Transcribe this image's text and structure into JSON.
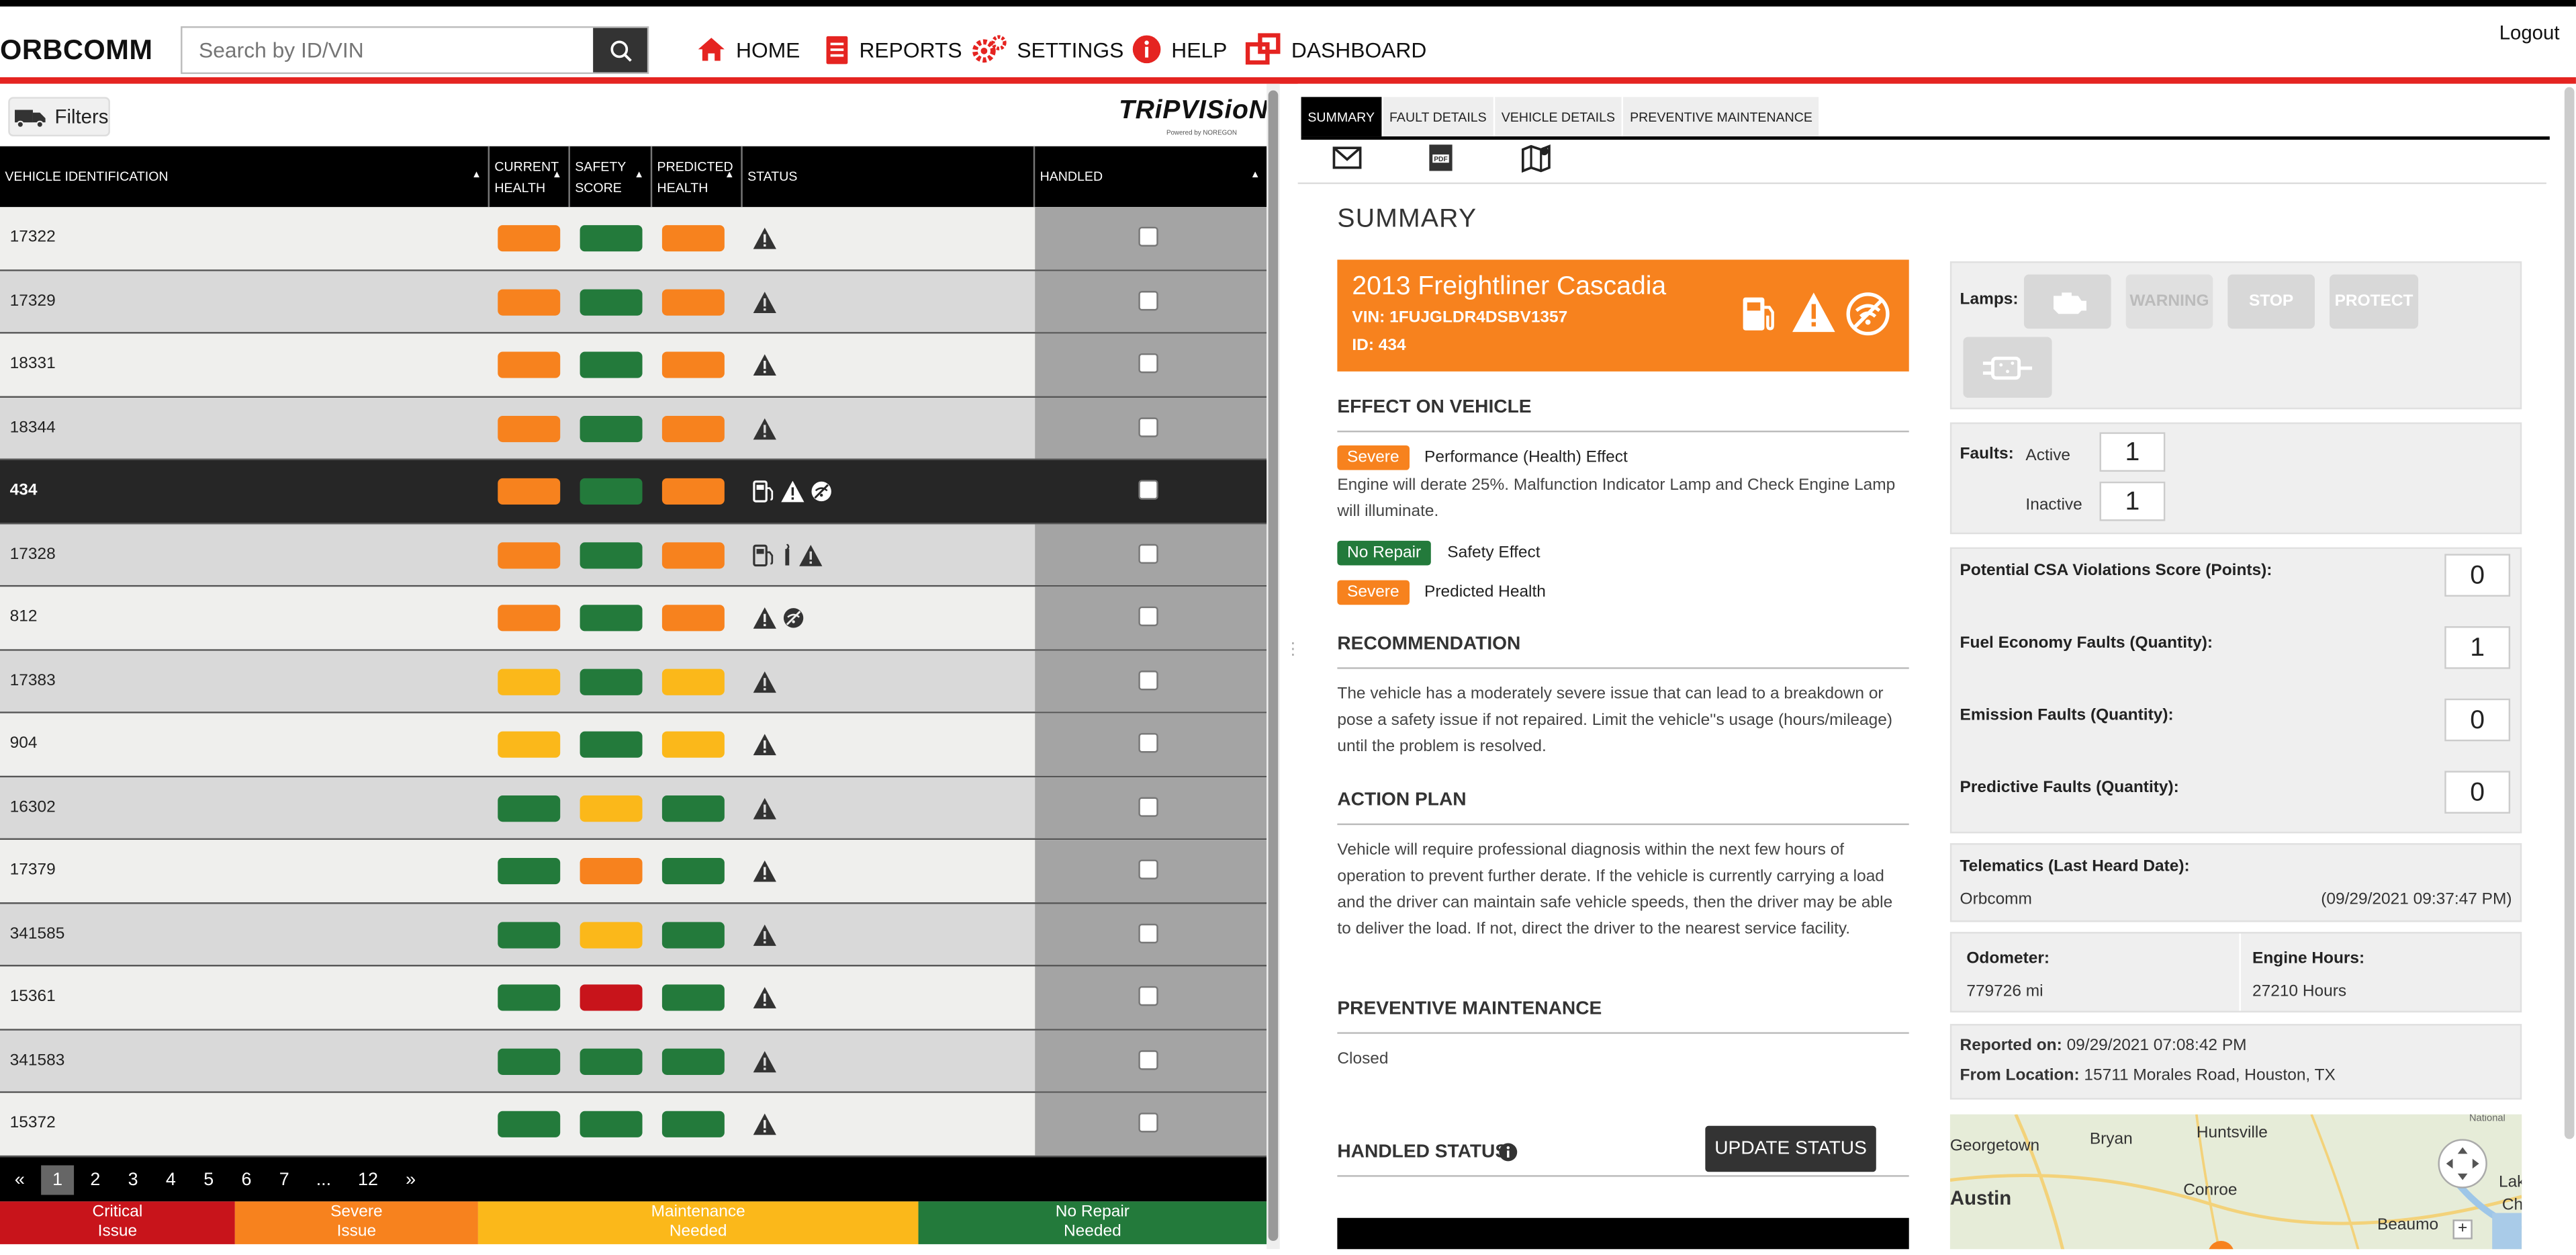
{
  "header": {
    "logo": "ORBCOMM",
    "search_placeholder": "Search by ID/VIN",
    "nav": [
      "HOME",
      "REPORTS",
      "SETTINGS",
      "HELP",
      "DASHBOARD"
    ],
    "logout": "Logout"
  },
  "left": {
    "filters_label": "Filters",
    "brand": "TRiPVISioN",
    "brand_sub": "Powered by NOREGON",
    "columns": [
      "VEHICLE IDENTIFICATION",
      "CURRENT HEALTH",
      "SAFETY SCORE",
      "PREDICTED HEALTH",
      "STATUS",
      "HANDLED"
    ],
    "rows": [
      {
        "id": "17322",
        "current": "orange",
        "safety": "green",
        "predicted": "orange",
        "status": [
          "warning"
        ]
      },
      {
        "id": "17329",
        "current": "orange",
        "safety": "green",
        "predicted": "orange",
        "status": [
          "warning"
        ]
      },
      {
        "id": "18331",
        "current": "orange",
        "safety": "green",
        "predicted": "orange",
        "status": [
          "warning"
        ]
      },
      {
        "id": "18344",
        "current": "orange",
        "safety": "green",
        "predicted": "orange",
        "status": [
          "warning"
        ]
      },
      {
        "id": "434",
        "current": "orange",
        "safety": "green",
        "predicted": "orange",
        "status": [
          "fuel",
          "warning",
          "no-wifi"
        ],
        "selected": true
      },
      {
        "id": "17328",
        "current": "orange",
        "safety": "green",
        "predicted": "orange",
        "status": [
          "fuel",
          "exhaust",
          "warning"
        ]
      },
      {
        "id": "812",
        "current": "orange",
        "safety": "green",
        "predicted": "orange",
        "status": [
          "warning",
          "no-wifi"
        ]
      },
      {
        "id": "17383",
        "current": "yellow",
        "safety": "green",
        "predicted": "yellow",
        "status": [
          "warning"
        ]
      },
      {
        "id": "904",
        "current": "yellow",
        "safety": "green",
        "predicted": "yellow",
        "status": [
          "warning"
        ]
      },
      {
        "id": "16302",
        "current": "green",
        "safety": "yellow",
        "predicted": "green",
        "status": [
          "warning"
        ]
      },
      {
        "id": "17379",
        "current": "green",
        "safety": "orange",
        "predicted": "green",
        "status": [
          "warning"
        ]
      },
      {
        "id": "341585",
        "current": "green",
        "safety": "yellow",
        "predicted": "green",
        "status": [
          "warning"
        ]
      },
      {
        "id": "15361",
        "current": "green",
        "safety": "red",
        "predicted": "green",
        "status": [
          "warning"
        ]
      },
      {
        "id": "341583",
        "current": "green",
        "safety": "green",
        "predicted": "green",
        "status": [
          "warning"
        ]
      },
      {
        "id": "15372",
        "current": "green",
        "safety": "green",
        "predicted": "green",
        "status": [
          "warning"
        ]
      }
    ],
    "pagination": [
      "«",
      "1",
      "2",
      "3",
      "4",
      "5",
      "6",
      "7",
      "...",
      "12",
      "»"
    ],
    "current_page": "1",
    "legend": [
      {
        "line1": "Critical",
        "line2": "Issue",
        "color": "#c8141b"
      },
      {
        "line1": "Severe",
        "line2": "Issue",
        "color": "#f7821e"
      },
      {
        "line1": "Maintenance",
        "line2": "Needed",
        "color": "#fbb81a"
      },
      {
        "line1": "No Repair",
        "line2": "Needed",
        "color": "#237a3b"
      }
    ]
  },
  "colors": {
    "orange": "#f7821e",
    "green": "#237a3b",
    "yellow": "#fbb81a",
    "red": "#c8141b"
  },
  "right": {
    "tabs": [
      "SUMMARY",
      "FAULT DETAILS",
      "VEHICLE DETAILS",
      "PREVENTIVE MAINTENANCE"
    ],
    "actions": [
      "email-icon",
      "pdf-icon",
      "map-icon"
    ],
    "summary_title": "SUMMARY",
    "vehicle": {
      "name": "2013 Freightliner Cascadia",
      "vin": "VIN: 1FUJGLDR4DSBV1357",
      "id": "ID: 434"
    },
    "effect_title": "EFFECT ON VEHICLE",
    "effects": [
      {
        "badge": "Severe",
        "label": "Performance (Health) Effect",
        "color": "#f7821e"
      },
      {
        "badge": "No Repair",
        "label": "Safety Effect",
        "color": "#237a3b"
      },
      {
        "badge": "Severe",
        "label": "Predicted Health",
        "color": "#f7821e"
      }
    ],
    "effect_desc": "Engine will derate 25%. Malfunction Indicator Lamp and Check Engine Lamp will illuminate.",
    "recommendation_title": "RECOMMENDATION",
    "recommendation": "The vehicle has a moderately severe issue that can lead to a breakdown or pose a safety issue if not repaired. Limit the vehicle''s usage (hours/mileage) until the problem is resolved.",
    "action_title": "ACTION PLAN",
    "action_plan": "Vehicle will require professional diagnosis within the next few hours of operation to prevent further derate. If the vehicle is currently carrying a load and the driver can maintain safe vehicle speeds, then the driver may be able to deliver the load. If not, direct the driver to the nearest service facility.",
    "pm_title": "PREVENTIVE MAINTENANCE",
    "pm_status": "Closed",
    "handled_title": "HANDLED STATUS",
    "update_button": "UPDATE STATUS",
    "lamps_label": "Lamps:",
    "lamps": [
      "WARNING",
      "STOP",
      "PROTECT"
    ],
    "faults_label": "Faults:",
    "active_label": "Active",
    "active_value": "1",
    "inactive_label": "Inactive",
    "inactive_value": "1",
    "metrics": [
      {
        "label": "Potential CSA Violations Score (Points):",
        "value": "0"
      },
      {
        "label": "Fuel Economy Faults (Quantity):",
        "value": "1"
      },
      {
        "label": "Emission Faults (Quantity):",
        "value": "0"
      },
      {
        "label": "Predictive Faults (Quantity):",
        "value": "0"
      }
    ],
    "telematics_label": "Telematics (Last Heard Date):",
    "telematics_source": "Orbcomm",
    "telematics_date": "(09/29/2021 09:37:47 PM)",
    "odometer_label": "Odometer:",
    "odometer_value": "779726 mi",
    "engine_hours_label": "Engine Hours:",
    "engine_hours_value": "27210 Hours",
    "reported_label": "Reported on:",
    "reported_value": "09/29/2021 07:08:42 PM",
    "location_label": "From Location:",
    "location_value": "15711 Morales Road, Houston, TX",
    "map_labels": [
      "Georgetown",
      "Bryan",
      "Huntsville",
      "Austin",
      "Conroe",
      "Lak",
      "Ch",
      "Beaumo",
      "National"
    ]
  }
}
